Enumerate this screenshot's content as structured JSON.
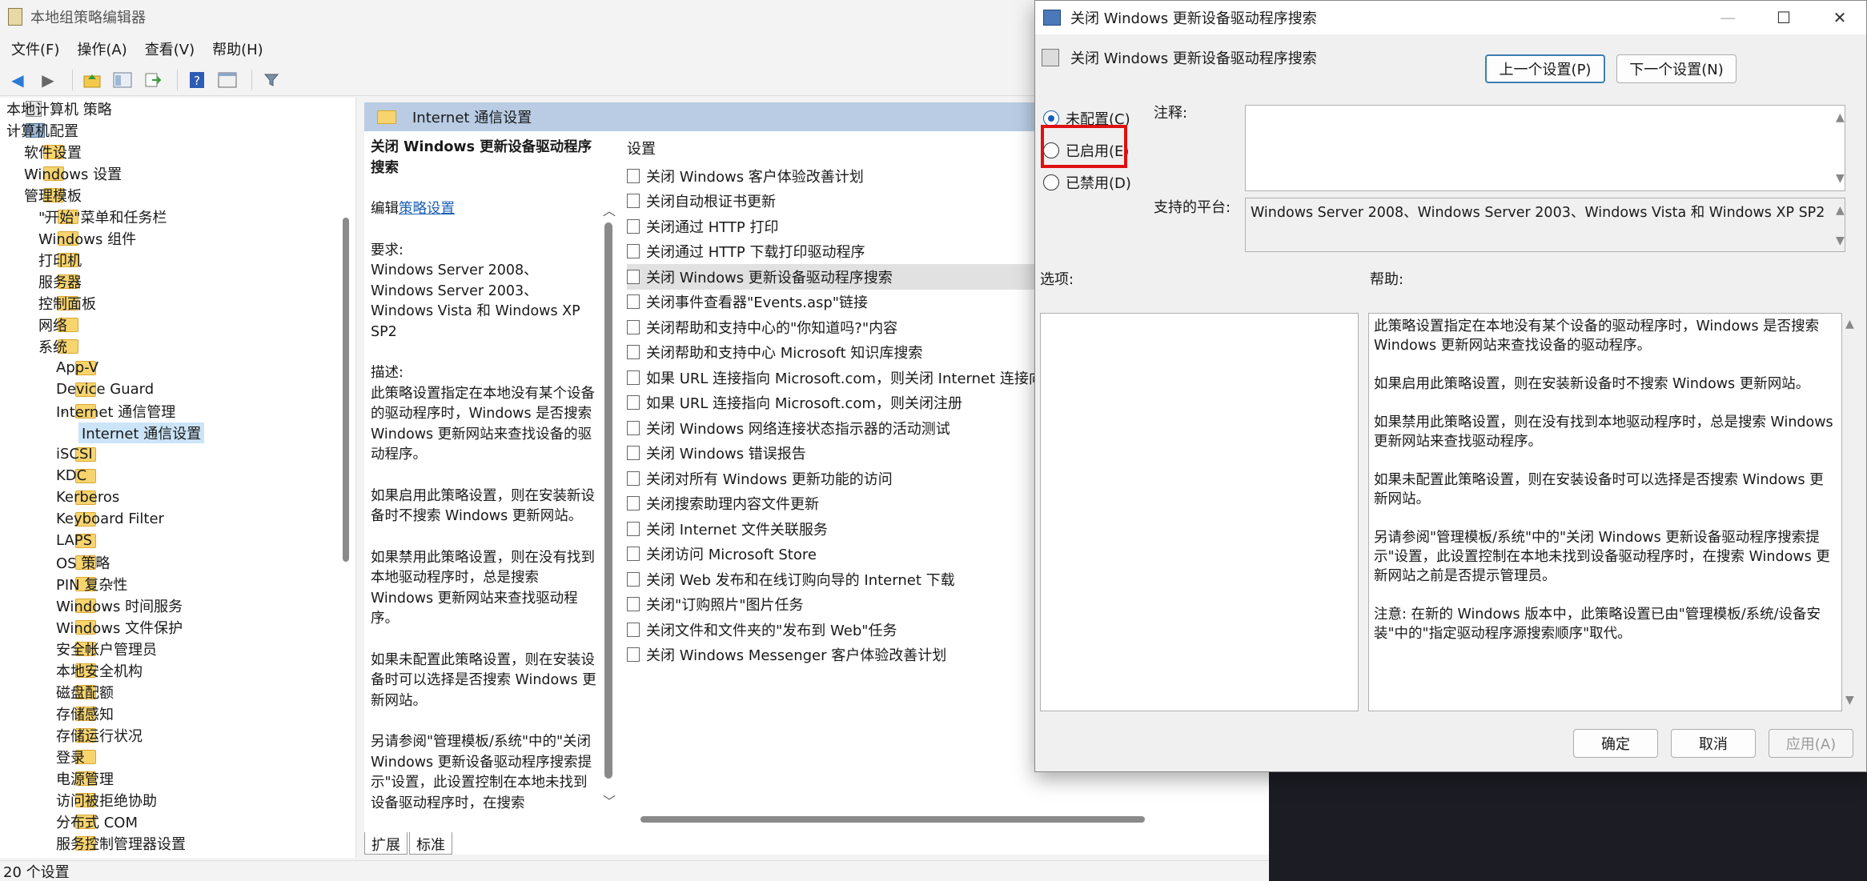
{
  "editor": {
    "title": "本地组策略编辑器",
    "menu": [
      "文件(F)",
      "操作(A)",
      "查看(V)",
      "帮助(H)"
    ],
    "tree": [
      {
        "label": "本地计算机 策略",
        "level": 0,
        "icon": "doc",
        "chev": ""
      },
      {
        "label": "计算机配置",
        "level": 0,
        "icon": "comp",
        "chev": "⌄"
      },
      {
        "label": "软件设置",
        "level": 1,
        "icon": "fold",
        "chev": "›"
      },
      {
        "label": "Windows 设置",
        "level": 1,
        "icon": "fold",
        "chev": "›"
      },
      {
        "label": "管理模板",
        "level": 1,
        "icon": "fold",
        "chev": "⌄"
      },
      {
        "label": "\"开始\"菜单和任务栏",
        "level": 2,
        "icon": "fold",
        "chev": "›"
      },
      {
        "label": "Windows 组件",
        "level": 2,
        "icon": "fold",
        "chev": "›"
      },
      {
        "label": "打印机",
        "level": 2,
        "icon": "fold",
        "chev": ""
      },
      {
        "label": "服务器",
        "level": 2,
        "icon": "fold",
        "chev": ""
      },
      {
        "label": "控制面板",
        "level": 2,
        "icon": "fold",
        "chev": "›"
      },
      {
        "label": "网络",
        "level": 2,
        "icon": "fold",
        "chev": "›"
      },
      {
        "label": "系统",
        "level": 2,
        "icon": "fold",
        "chev": "⌄"
      },
      {
        "label": "App-V",
        "level": 3,
        "icon": "fold",
        "chev": "›"
      },
      {
        "label": "Device Guard",
        "level": 3,
        "icon": "fold",
        "chev": ""
      },
      {
        "label": "Internet 通信管理",
        "level": 3,
        "icon": "fold",
        "chev": "⌄"
      },
      {
        "label": "Internet 通信设置",
        "level": 4,
        "icon": "fold",
        "chev": "",
        "selected": true
      },
      {
        "label": "iSCSI",
        "level": 3,
        "icon": "fold",
        "chev": "›"
      },
      {
        "label": "KDC",
        "level": 3,
        "icon": "fold",
        "chev": ""
      },
      {
        "label": "Kerberos",
        "level": 3,
        "icon": "fold",
        "chev": ""
      },
      {
        "label": "Keyboard Filter",
        "level": 3,
        "icon": "fold",
        "chev": ""
      },
      {
        "label": "LAPS",
        "level": 3,
        "icon": "fold",
        "chev": ""
      },
      {
        "label": "OS 策略",
        "level": 3,
        "icon": "fold",
        "chev": ""
      },
      {
        "label": "PIN 复杂性",
        "level": 3,
        "icon": "fold",
        "chev": ""
      },
      {
        "label": "Windows 时间服务",
        "level": 3,
        "icon": "fold",
        "chev": "›"
      },
      {
        "label": "Windows 文件保护",
        "level": 3,
        "icon": "fold",
        "chev": ""
      },
      {
        "label": "安全帐户管理员",
        "level": 3,
        "icon": "fold",
        "chev": ""
      },
      {
        "label": "本地安全机构",
        "level": 3,
        "icon": "fold",
        "chev": ""
      },
      {
        "label": "磁盘配额",
        "level": 3,
        "icon": "fold",
        "chev": ""
      },
      {
        "label": "存储感知",
        "level": 3,
        "icon": "fold",
        "chev": ""
      },
      {
        "label": "存储运行状况",
        "level": 3,
        "icon": "fold",
        "chev": ""
      },
      {
        "label": "登录",
        "level": 3,
        "icon": "fold",
        "chev": ""
      },
      {
        "label": "电源管理",
        "level": 3,
        "icon": "fold",
        "chev": "›"
      },
      {
        "label": "访问被拒绝协助",
        "level": 3,
        "icon": "fold",
        "chev": ""
      },
      {
        "label": "分布式 COM",
        "level": 3,
        "icon": "fold",
        "chev": "›"
      },
      {
        "label": "服务控制管理器设置",
        "level": 3,
        "icon": "fold",
        "chev": "›"
      }
    ],
    "pane_header": "Internet 通信设置",
    "desc": {
      "title": "关闭 Windows 更新设备驱动程序搜索",
      "edit_prefix": "编辑",
      "edit_link": "策略设置",
      "req_label": "要求:",
      "req_text": "Windows Server 2008、Windows Server 2003、Windows Vista 和 Windows XP SP2",
      "desc_label": "描述:",
      "p1": "此策略设置指定在本地没有某个设备的驱动程序时，Windows 是否搜索 Windows 更新网站来查找设备的驱动程序。",
      "p2": "如果启用此策略设置，则在安装新设备时不搜索 Windows 更新网站。",
      "p3": "如果禁用此策略设置，则在没有找到本地驱动程序时，总是搜索 Windows 更新网站来查找驱动程序。",
      "p4": "如果未配置此策略设置，则在安装设备时可以选择是否搜索 Windows 更新网站。",
      "p5": "另请参阅\"管理模板/系统\"中的\"关闭 Windows 更新设备驱动程序搜索提示\"设置，此设置控制在本地未找到设备驱动程序时，在搜索"
    },
    "list_header": "设置",
    "settings": [
      "关闭 Windows 客户体验改善计划",
      "关闭自动根证书更新",
      "关闭通过 HTTP 打印",
      "关闭通过 HTTP 下载打印驱动程序",
      "关闭 Windows 更新设备驱动程序搜索",
      "关闭事件查看器\"Events.asp\"链接",
      "关闭帮助和支持中心的\"你知道吗?\"内容",
      "关闭帮助和支持中心 Microsoft 知识库搜索",
      "如果 URL 连接指向 Microsoft.com，则关闭 Internet 连接向...",
      "如果 URL 连接指向 Microsoft.com，则关闭注册",
      "关闭 Windows 网络连接状态指示器的活动测试",
      "关闭 Windows 错误报告",
      "关闭对所有 Windows 更新功能的访问",
      "关闭搜索助理内容文件更新",
      "关闭 Internet 文件关联服务",
      "关闭访问 Microsoft Store",
      "关闭 Web 发布和在线订购向导的 Internet 下载",
      "关闭\"订购照片\"图片任务",
      "关闭文件和文件夹的\"发布到 Web\"任务",
      "关闭 Windows Messenger 客户体验改善计划"
    ],
    "selected_setting_index": 4,
    "tabs": [
      "扩展",
      "标准"
    ],
    "status": "20 个设置"
  },
  "dialog": {
    "title": "关闭 Windows 更新设备驱动程序搜索",
    "subtitle": "关闭 Windows 更新设备驱动程序搜索",
    "prev_btn": "上一个设置(P)",
    "next_btn": "下一个设置(N)",
    "radio_not_configured": "未配置(C)",
    "radio_enabled": "已启用(E)",
    "radio_disabled": "已禁用(D)",
    "comment_label": "注释:",
    "platform_label": "支持的平台:",
    "platform_text": "Windows Server 2008、Windows Server 2003、Windows Vista 和 Windows XP SP2",
    "options_label": "选项:",
    "help_label": "帮助:",
    "help": {
      "p1": "此策略设置指定在本地没有某个设备的驱动程序时，Windows 是否搜索 Windows 更新网站来查找设备的驱动程序。",
      "p2": "如果启用此策略设置，则在安装新设备时不搜索 Windows 更新网站。",
      "p3": "如果禁用此策略设置，则在没有找到本地驱动程序时，总是搜索 Windows 更新网站来查找驱动程序。",
      "p4": "如果未配置此策略设置，则在安装设备时可以选择是否搜索 Windows 更新网站。",
      "p5": "另请参阅\"管理模板/系统\"中的\"关闭 Windows 更新设备驱动程序搜索提示\"设置，此设置控制在本地未找到设备驱动程序时，在搜索 Windows 更新网站之前是否提示管理员。",
      "p6": "注意: 在新的 Windows 版本中，此策略设置已由\"管理模板/系统/设备安装\"中的\"指定驱动程序源搜索顺序\"取代。"
    },
    "ok_btn": "确定",
    "cancel_btn": "取消",
    "apply_btn": "应用(A)"
  }
}
